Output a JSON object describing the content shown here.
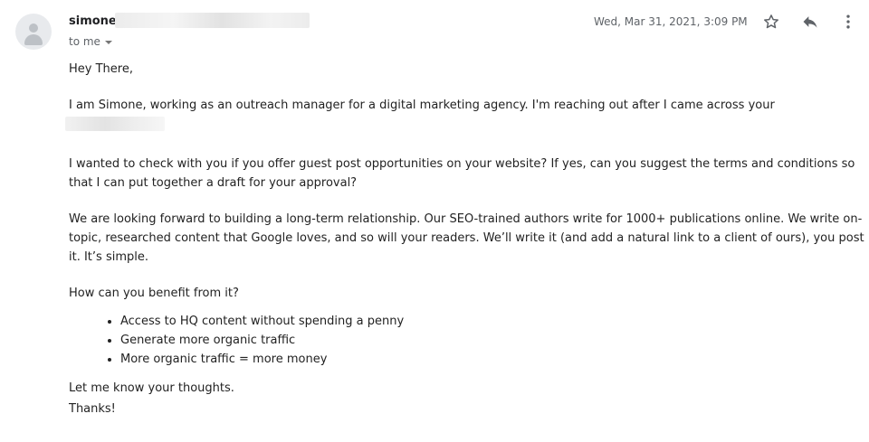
{
  "email": {
    "sender_name": "simone",
    "recipient_label": "to me",
    "date": "Wed, Mar 31, 2021, 3:09 PM",
    "icons": {
      "avatar": "person-avatar-icon",
      "star": "star-icon",
      "reply": "reply-icon",
      "more": "more-vert-icon",
      "recipient_dropdown": "caret-down-icon"
    },
    "body": {
      "greeting": "Hey There,",
      "intro": "I am Simone, working as an outreach manager for a digital marketing agency. I'm reaching out after I came across your",
      "check": "I wanted to check with you if you offer guest post opportunities on your website? If yes, can you suggest the terms and conditions so that I can put together a draft for your approval?",
      "forward": "We are looking forward to building a long-term relationship. Our SEO-trained authors write for 1000+ publications online. We write on-topic, researched content that Google loves, and so will your readers. We’ll write it (and add a natural link to a client of ours), you post it. It’s simple.",
      "question": "How can you benefit from it?",
      "bullets": [
        "Access to HQ content without spending a penny",
        "Generate more organic traffic",
        "More organic traffic = more money"
      ],
      "thoughts": "Let me know your thoughts.",
      "thanks": "Thanks!"
    }
  }
}
